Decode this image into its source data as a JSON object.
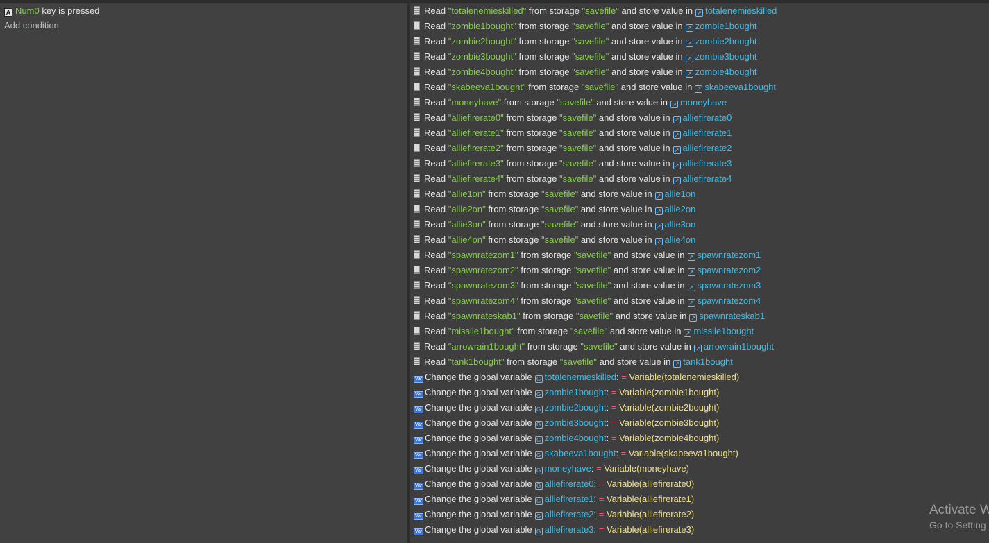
{
  "condition": {
    "icon": "keyboard-icon",
    "key_name": "Num0",
    "text": "key is pressed",
    "key_color": "#7fd43a"
  },
  "add_condition_label": "Add condition",
  "read_actions": [
    {
      "key": "\"totalenemieskilled\"",
      "storage": "\"savefile\"",
      "var": "totalenemieskilled"
    },
    {
      "key": "\"zombie1bought\"",
      "storage": "\"savefile\"",
      "var": "zombie1bought"
    },
    {
      "key": "\"zombie2bought\"",
      "storage": "\"savefile\"",
      "var": "zombie2bought"
    },
    {
      "key": "\"zombie3bought\"",
      "storage": "\"savefile\"",
      "var": "zombie3bought"
    },
    {
      "key": "\"zombie4bought\"",
      "storage": "\"savefile\"",
      "var": "zombie4bought"
    },
    {
      "key": "\"skabeeva1bought\"",
      "storage": "\"savefile\"",
      "var": "skabeeva1bought"
    },
    {
      "key": "\"moneyhave\"",
      "storage": "\"savefile\"",
      "var": "moneyhave"
    },
    {
      "key": "\"alliefirerate0\"",
      "storage": "\"savefile\"",
      "var": "alliefirerate0"
    },
    {
      "key": "\"alliefirerate1\"",
      "storage": "\"savefile\"",
      "var": "alliefirerate1"
    },
    {
      "key": "\"alliefirerate2\"",
      "storage": "\"savefile\"",
      "var": "alliefirerate2"
    },
    {
      "key": "\"alliefirerate3\"",
      "storage": "\"savefile\"",
      "var": "alliefirerate3"
    },
    {
      "key": "\"alliefirerate4\"",
      "storage": "\"savefile\"",
      "var": "alliefirerate4"
    },
    {
      "key": "\"allie1on\"",
      "storage": "\"savefile\"",
      "var": "allie1on"
    },
    {
      "key": "\"allie2on\"",
      "storage": "\"savefile\"",
      "var": "allie2on"
    },
    {
      "key": "\"allie3on\"",
      "storage": "\"savefile\"",
      "var": "allie3on"
    },
    {
      "key": "\"allie4on\"",
      "storage": "\"savefile\"",
      "var": "allie4on"
    },
    {
      "key": "\"spawnratezom1\"",
      "storage": "\"savefile\"",
      "var": "spawnratezom1"
    },
    {
      "key": "\"spawnratezom2\"",
      "storage": "\"savefile\"",
      "var": "spawnratezom2"
    },
    {
      "key": "\"spawnratezom3\"",
      "storage": "\"savefile\"",
      "var": "spawnratezom3"
    },
    {
      "key": "\"spawnratezom4\"",
      "storage": "\"savefile\"",
      "var": "spawnratezom4"
    },
    {
      "key": "\"spawnrateskab1\"",
      "storage": "\"savefile\"",
      "var": "spawnrateskab1"
    },
    {
      "key": "\"missile1bought\"",
      "storage": "\"savefile\"",
      "var": "missile1bought"
    },
    {
      "key": "\"arrowrain1bought\"",
      "storage": "\"savefile\"",
      "var": "arrowrain1bought"
    },
    {
      "key": "\"tank1bought\"",
      "storage": "\"savefile\"",
      "var": "tank1bought"
    }
  ],
  "read_labels": {
    "read": "Read",
    "from_storage": "from storage",
    "store_in": "and store value in"
  },
  "change_actions": [
    {
      "var": "totalenemieskilled",
      "expr": "Variable(totalenemieskilled)"
    },
    {
      "var": "zombie1bought",
      "expr": "Variable(zombie1bought)"
    },
    {
      "var": "zombie2bought",
      "expr": "Variable(zombie2bought)"
    },
    {
      "var": "zombie3bought",
      "expr": "Variable(zombie3bought)"
    },
    {
      "var": "zombie4bought",
      "expr": "Variable(zombie4bought)"
    },
    {
      "var": "skabeeva1bought",
      "expr": "Variable(skabeeva1bought)"
    },
    {
      "var": "moneyhave",
      "expr": "Variable(moneyhave)"
    },
    {
      "var": "alliefirerate0",
      "expr": "Variable(alliefirerate0)"
    },
    {
      "var": "alliefirerate1",
      "expr": "Variable(alliefirerate1)"
    },
    {
      "var": "alliefirerate2",
      "expr": "Variable(alliefirerate2)"
    },
    {
      "var": "alliefirerate3",
      "expr": "Variable(alliefirerate3)"
    }
  ],
  "change_labels": {
    "prefix": "Change the global variable",
    "colon": ":",
    "op": "="
  },
  "watermark": {
    "line1": "Activate W",
    "line2": "Go to Setting"
  },
  "colors": {
    "string": "#7fd43a",
    "variable": "#33c0f0",
    "operator": "#ff4f7a",
    "expression": "#f0e080",
    "panel_bg": "#414141"
  },
  "icons": {
    "read_action": "file-icon",
    "variable_action": "variable-action-icon",
    "variable_ref": "variable-icon"
  }
}
